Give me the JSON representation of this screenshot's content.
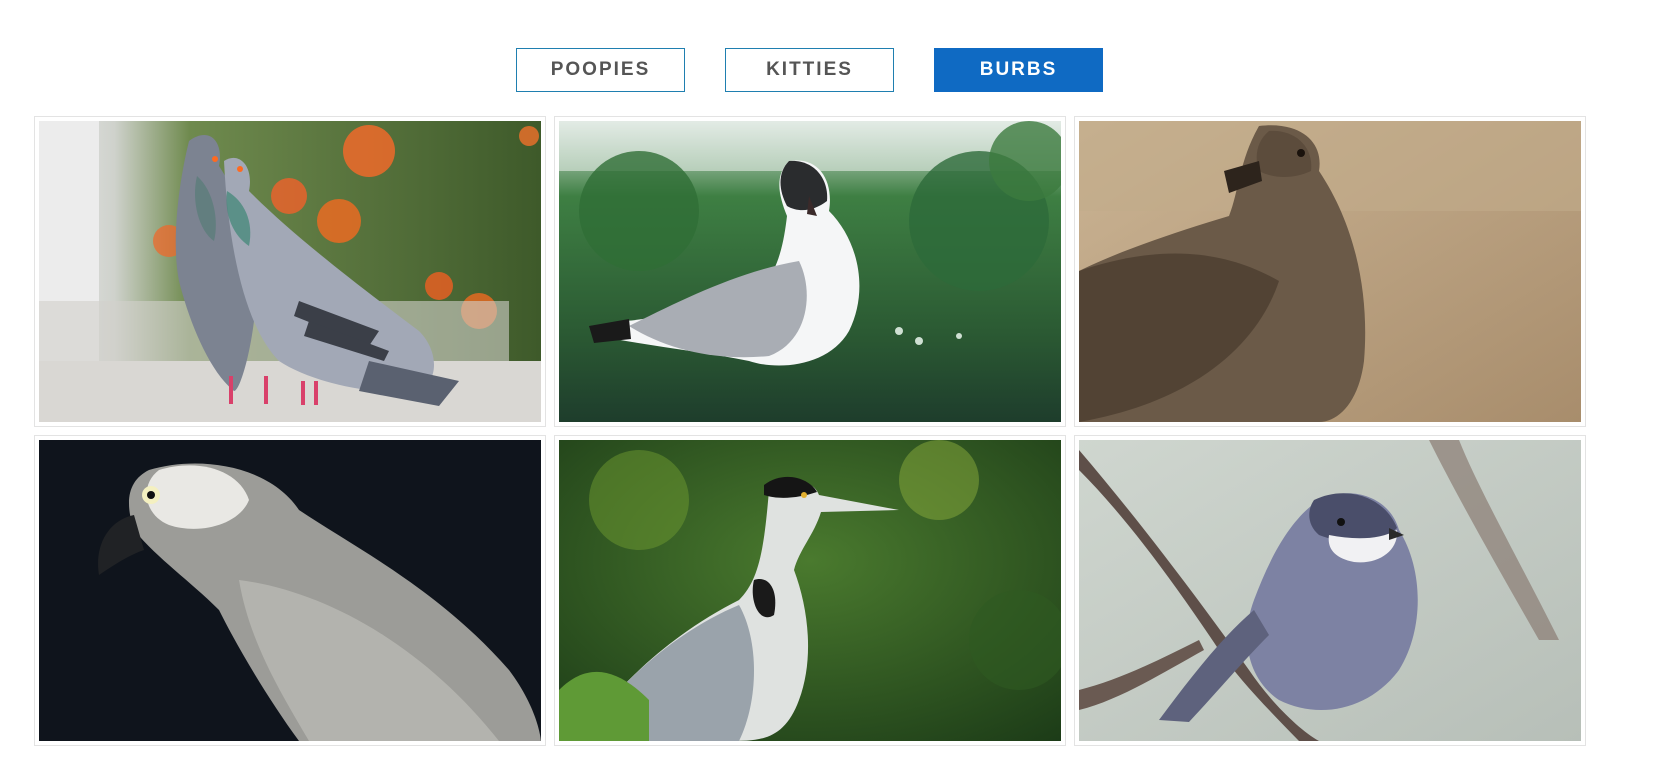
{
  "filters": {
    "items": [
      {
        "label": "POOPIES",
        "active": false
      },
      {
        "label": "KITTIES",
        "active": false
      },
      {
        "label": "BURBS",
        "active": true
      }
    ]
  },
  "gallery": {
    "images": [
      {
        "subject": "pigeons-pair-photo"
      },
      {
        "subject": "seagull-photo"
      },
      {
        "subject": "brown-seabird-photo"
      },
      {
        "subject": "grey-parrot-photo"
      },
      {
        "subject": "heron-photo"
      },
      {
        "subject": "grey-songbird-on-branch-photo"
      }
    ]
  },
  "colors": {
    "accent": "#0f6ac3",
    "button_border": "#1f7fb0",
    "button_text": "#555555"
  }
}
